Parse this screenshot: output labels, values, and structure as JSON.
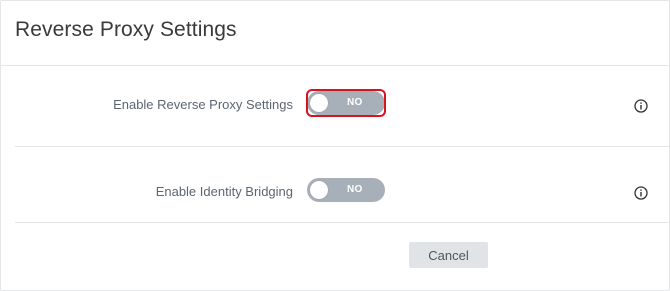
{
  "dialog": {
    "title": "Reverse Proxy Settings"
  },
  "settings": [
    {
      "label": "Enable Reverse Proxy Settings",
      "toggle_state": "NO",
      "enabled": false,
      "highlighted": true,
      "info_icon": "info-circle-icon"
    },
    {
      "label": "Enable Identity Bridging",
      "toggle_state": "NO",
      "enabled": false,
      "highlighted": false,
      "info_icon": "info-circle-icon"
    }
  ],
  "footer": {
    "cancel_label": "Cancel"
  },
  "colors": {
    "toggle_off": "#a7b0b9",
    "highlight_border": "#d9121f",
    "button_bg": "#e1e4e7",
    "label_text": "#5b6670"
  }
}
